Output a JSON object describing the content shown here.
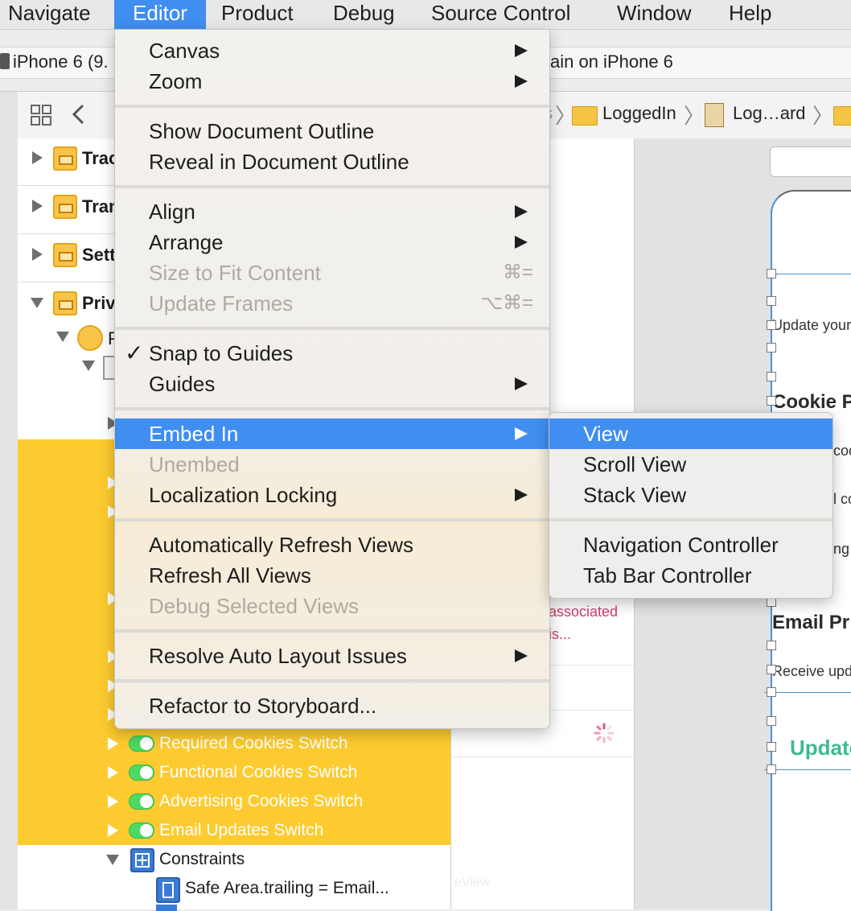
{
  "menubar": {
    "items": [
      "Navigate",
      "Editor",
      "Product",
      "Debug",
      "Source Control",
      "Window",
      "Help"
    ],
    "active": "Editor"
  },
  "toolbar": {
    "scheme_device": "iPhone 6 (9.",
    "status_fragment": "ain on iPhone 6"
  },
  "jumpbar": {
    "fragment": "s",
    "crumbs": [
      "LoggedIn",
      "Log…ard"
    ]
  },
  "outline": {
    "top_items": [
      "Trac",
      "Tran",
      "Sett",
      "Priv"
    ],
    "partial_child": "P",
    "switch_rows": [
      "Required Cookies Switch",
      "Functional Cookies Switch",
      "Advertising Cookies Switch",
      "Email Updates Switch"
    ],
    "constraints_label": "Constraints",
    "constraint_item": "Safe Area.trailing = Email..."
  },
  "canvas": {
    "associated_line1": "associated",
    "associated_line2": "is...",
    "update_your": "Update your",
    "cookie_heading": "Cookie P",
    "frag_coo": "coo",
    "frag_lco": "l co",
    "frag_ng": "ng",
    "email_heading": "Email Pr",
    "receive_upd": "Receive upd",
    "update_button": "Update",
    "watermark": "eView"
  },
  "editor_menu": {
    "groups": [
      [
        {
          "label": "Canvas",
          "submenu": true
        },
        {
          "label": "Zoom",
          "submenu": true
        }
      ],
      [
        {
          "label": "Show Document Outline"
        },
        {
          "label": "Reveal in Document Outline"
        }
      ],
      [
        {
          "label": "Align",
          "submenu": true
        },
        {
          "label": "Arrange",
          "submenu": true
        },
        {
          "label": "Size to Fit Content",
          "disabled": true,
          "shortcut": "⌘="
        },
        {
          "label": "Update Frames",
          "disabled": true,
          "shortcut": "⌥⌘="
        }
      ],
      [
        {
          "label": "Snap to Guides",
          "checked": true
        },
        {
          "label": "Guides",
          "submenu": true
        }
      ],
      [
        {
          "label": "Embed In",
          "submenu": true,
          "highlighted": true
        },
        {
          "label": "Unembed",
          "disabled": true
        },
        {
          "label": "Localization Locking",
          "submenu": true
        }
      ],
      [
        {
          "label": "Automatically Refresh Views"
        },
        {
          "label": "Refresh All Views"
        },
        {
          "label": "Debug Selected Views",
          "disabled": true
        }
      ],
      [
        {
          "label": "Resolve Auto Layout Issues",
          "submenu": true
        }
      ],
      [
        {
          "label": "Refactor to Storyboard..."
        }
      ]
    ]
  },
  "embed_submenu": {
    "items": [
      "View",
      "Scroll View",
      "Stack View",
      "Navigation Controller",
      "Tab Bar Controller"
    ],
    "highlighted": "View"
  },
  "colors": {
    "menu_highlight": "#3f8ef0",
    "outline_selection": "#fdcb2f",
    "switch_on": "#4cd964",
    "update_button_text": "#3dbb8f",
    "warning_text": "#d43b6a"
  }
}
